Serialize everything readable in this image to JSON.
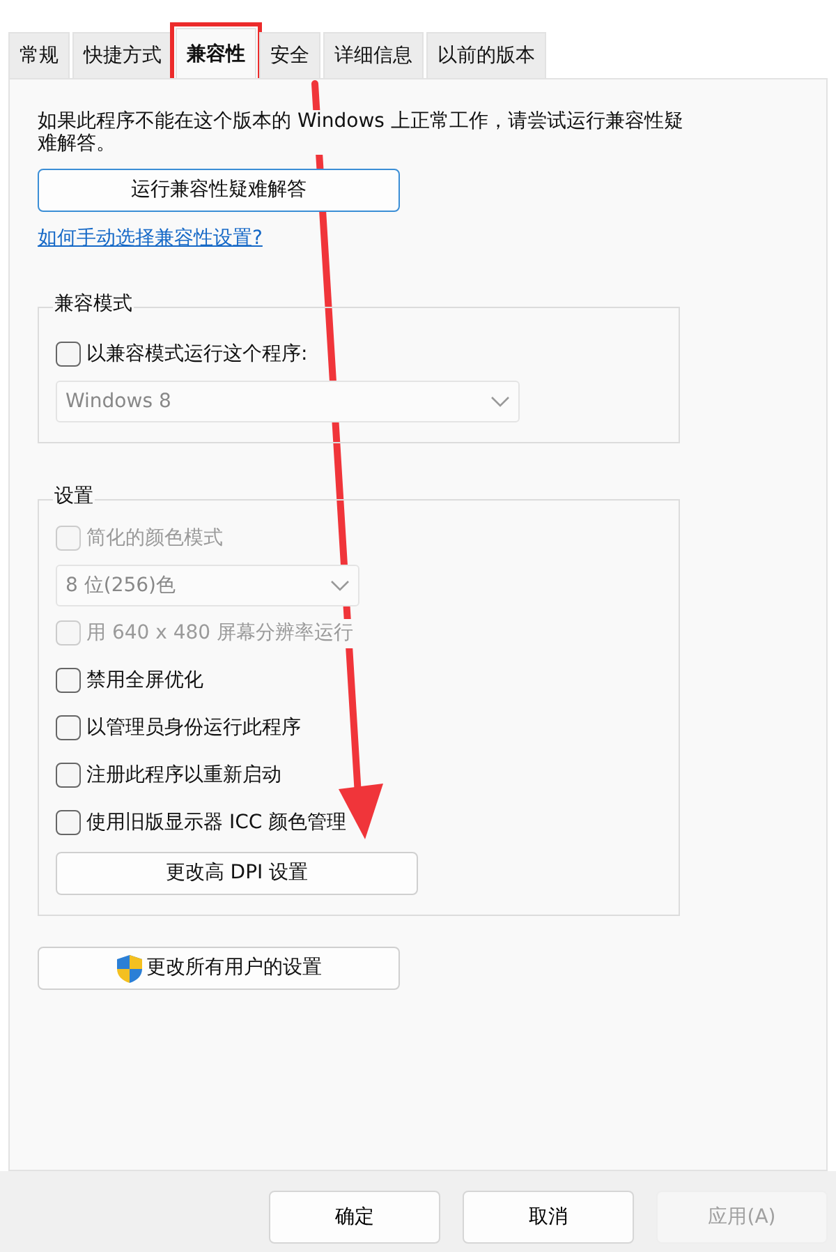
{
  "tabs": [
    {
      "label": "常规",
      "selected": false,
      "highlighted": false
    },
    {
      "label": "快捷方式",
      "selected": false,
      "highlighted": false
    },
    {
      "label": "兼容性",
      "selected": true,
      "highlighted": true
    },
    {
      "label": "安全",
      "selected": false,
      "highlighted": false
    },
    {
      "label": "详细信息",
      "selected": false,
      "highlighted": false
    },
    {
      "label": "以前的版本",
      "selected": false,
      "highlighted": false
    }
  ],
  "intro": "如果此程序不能在这个版本的 Windows 上正常工作，请尝试运行兼容性疑难解答。",
  "troubleshoot_button": "运行兼容性疑难解答",
  "help_link": "如何手动选择兼容性设置?",
  "compat_mode": {
    "title": "兼容模式",
    "checkbox": {
      "label": "以兼容模式运行这个程序:",
      "checked": false,
      "disabled": false
    },
    "select": {
      "value": "Windows 8",
      "disabled": true
    }
  },
  "settings": {
    "title": "设置",
    "items": [
      {
        "kind": "checkbox",
        "label": "简化的颜色模式",
        "checked": false,
        "disabled": true
      },
      {
        "kind": "select",
        "value": "8 位(256)色",
        "disabled": true
      },
      {
        "kind": "checkbox",
        "label": "用 640 x 480 屏幕分辨率运行",
        "checked": false,
        "disabled": true
      },
      {
        "kind": "checkbox",
        "label": "禁用全屏优化",
        "checked": false,
        "disabled": false
      },
      {
        "kind": "checkbox",
        "label": "以管理员身份运行此程序",
        "checked": false,
        "disabled": false
      },
      {
        "kind": "checkbox",
        "label": "注册此程序以重新启动",
        "checked": false,
        "disabled": false
      },
      {
        "kind": "checkbox",
        "label": "使用旧版显示器 ICC 颜色管理",
        "checked": false,
        "disabled": false
      },
      {
        "kind": "button",
        "label": "更改高 DPI 设置"
      }
    ]
  },
  "all_users_button": "更改所有用户的设置",
  "footer_buttons": [
    {
      "label": "确定",
      "disabled": false
    },
    {
      "label": "取消",
      "disabled": false
    },
    {
      "label": "应用(A)",
      "disabled": true
    }
  ]
}
